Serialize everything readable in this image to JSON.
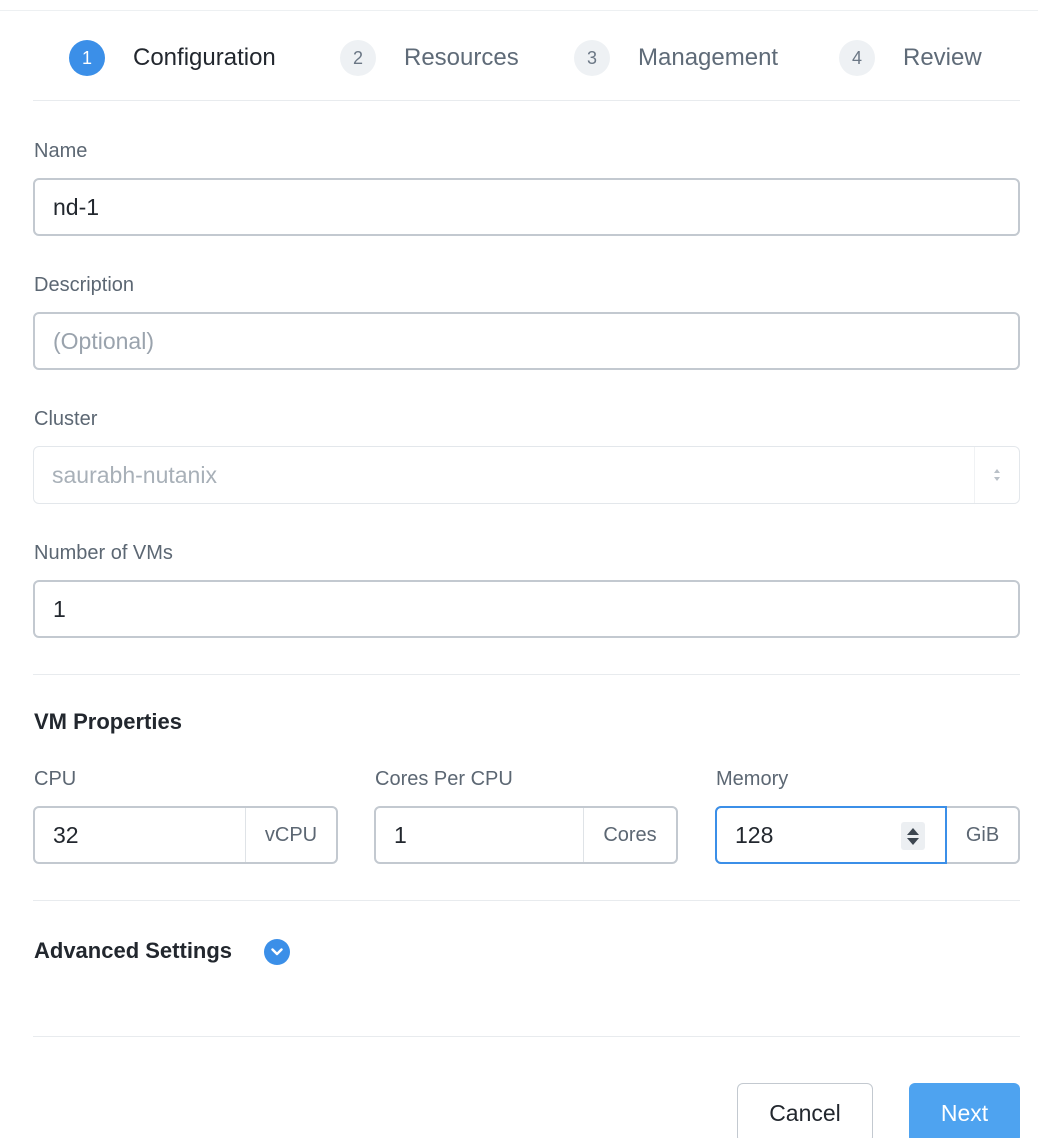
{
  "stepper": {
    "steps": [
      {
        "number": "1",
        "label": "Configuration",
        "active": true
      },
      {
        "number": "2",
        "label": "Resources",
        "active": false
      },
      {
        "number": "3",
        "label": "Management",
        "active": false
      },
      {
        "number": "4",
        "label": "Review",
        "active": false
      }
    ]
  },
  "form": {
    "name": {
      "label": "Name",
      "value": "nd-1"
    },
    "description": {
      "label": "Description",
      "value": "",
      "placeholder": "(Optional)"
    },
    "cluster": {
      "label": "Cluster",
      "value": "saurabh-nutanix"
    },
    "num_vms": {
      "label": "Number of VMs",
      "value": "1"
    }
  },
  "vm_properties": {
    "title": "VM Properties",
    "cpu": {
      "label": "CPU",
      "value": "32",
      "unit": "vCPU"
    },
    "cores": {
      "label": "Cores Per CPU",
      "value": "1",
      "unit": "Cores"
    },
    "memory": {
      "label": "Memory",
      "value": "128",
      "unit": "GiB"
    }
  },
  "advanced": {
    "title": "Advanced Settings"
  },
  "footer": {
    "cancel_label": "Cancel",
    "next_label": "Next"
  },
  "colors": {
    "accent": "#3b8fe8",
    "primary_button": "#4ea3f0",
    "border": "#c3c9d0"
  }
}
